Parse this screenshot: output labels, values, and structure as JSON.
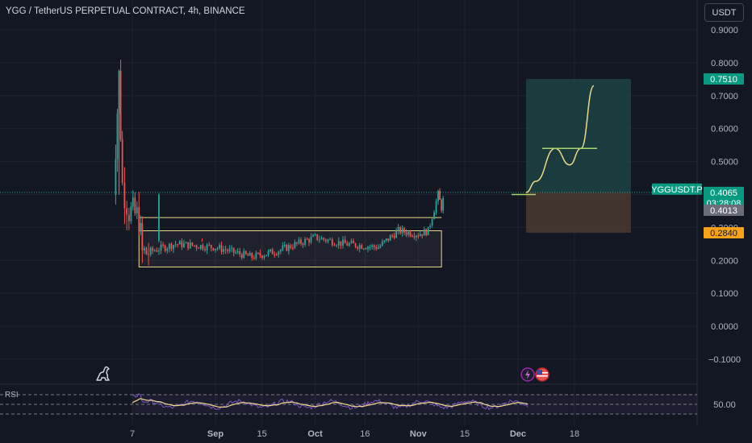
{
  "header": {
    "title": "YGG / TetherUS PERPETUAL CONTRACT, 4h, BINANCE",
    "currency_button": "USDT"
  },
  "price_axis": {
    "ticks": [
      "0.9000",
      "0.8000",
      "0.7000",
      "0.6000",
      "0.5000",
      "0.4000",
      "0.3000",
      "0.2000",
      "0.1000",
      "0.0000",
      "−0.1000"
    ],
    "badges": [
      {
        "key": "target",
        "text": "0.7510",
        "color": "#089981"
      },
      {
        "key": "symbol",
        "text": "YGGUSDT.P",
        "color": "#089981"
      },
      {
        "key": "last",
        "text": "0.4065",
        "color": "#089981"
      },
      {
        "key": "countdown",
        "text": "03:28:08",
        "color": "#089981"
      },
      {
        "key": "cross",
        "text": "0.4013",
        "color": "#6a6d78"
      },
      {
        "key": "stop",
        "text": "0.2840",
        "color": "#f7a21b"
      }
    ]
  },
  "time_axis": {
    "labels": [
      "7",
      "Sep",
      "15",
      "Oct",
      "16",
      "Nov",
      "15",
      "Dec",
      "18"
    ],
    "bold": [
      "Sep",
      "Oct",
      "Nov",
      "Dec"
    ]
  },
  "rsi": {
    "label": "RSI",
    "level_label": "50.00"
  },
  "icons": {
    "logo": "tradingview-dino-icon",
    "events": [
      "lightning-event-icon",
      "us-flag-event-icon"
    ]
  },
  "colors": {
    "background": "#131722",
    "grid": "#1f2330",
    "up": "#26a69a",
    "down": "#ef5350",
    "annotation": "#f0d889",
    "profit_zone": "#1e4a48",
    "loss_zone": "#4a3a2b",
    "rsi_line": "#7e57c2",
    "rsi_ma": "#f0d889"
  },
  "chart_data": {
    "type": "candlestick",
    "symbol": "YGGUSDT.P",
    "interval": "4h",
    "x_labels": [
      "7",
      "Sep",
      "15",
      "Oct",
      "16",
      "Nov",
      "15",
      "Dec",
      "18"
    ],
    "ylim": [
      -0.12,
      0.93
    ],
    "last_price": 0.4065,
    "position": {
      "entry": 0.4065,
      "target": 0.751,
      "stop": 0.284
    },
    "annotations": [
      {
        "type": "range-box",
        "top": 0.29,
        "bottom": 0.18,
        "from": "Aug 9",
        "to": "Nov 8"
      },
      {
        "type": "horizontal-line",
        "value": 0.33,
        "from": "Aug 9",
        "to": "Nov 8"
      },
      {
        "type": "projected-path",
        "points": [
          0.4065,
          0.44,
          0.54,
          0.49,
          0.54,
          0.73
        ]
      }
    ],
    "price_path": [
      {
        "t": "Jul 29",
        "v": 0.26
      },
      {
        "t": "Aug 2",
        "v": 0.55
      },
      {
        "t": "Aug 3",
        "v": 0.76
      },
      {
        "t": "Aug 4",
        "v": 0.43
      },
      {
        "t": "Aug 6",
        "v": 0.35
      },
      {
        "t": "Aug 9",
        "v": 0.33
      },
      {
        "t": "Aug 10",
        "v": 0.22
      },
      {
        "t": "Aug 20",
        "v": 0.25
      },
      {
        "t": "Sep 1",
        "v": 0.24
      },
      {
        "t": "Sep 12",
        "v": 0.21
      },
      {
        "t": "Sep 20",
        "v": 0.23
      },
      {
        "t": "Oct 1",
        "v": 0.27
      },
      {
        "t": "Oct 10",
        "v": 0.25
      },
      {
        "t": "Oct 20",
        "v": 0.24
      },
      {
        "t": "Oct 26",
        "v": 0.29
      },
      {
        "t": "Nov 1",
        "v": 0.28
      },
      {
        "t": "Nov 4",
        "v": 0.29
      },
      {
        "t": "Nov 7",
        "v": 0.4
      },
      {
        "t": "Nov 8",
        "v": 0.36
      },
      {
        "t": "Nov 9",
        "v": 0.4065
      }
    ],
    "rsi_level": 50.0
  }
}
